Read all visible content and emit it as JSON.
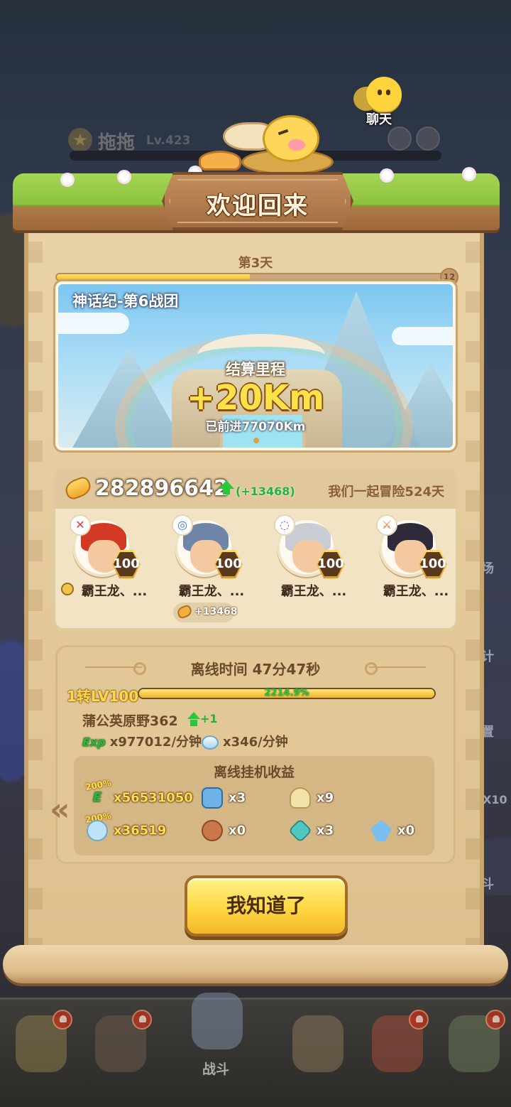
{
  "chat_label": "聊天",
  "player": {
    "name": "拖拖",
    "level": "Lv.423"
  },
  "popup": {
    "title": "欢迎回来",
    "day_label": "第3天",
    "day_progress": 0.5,
    "day_badge": "12",
    "map": {
      "name": "神话纪-第6战团",
      "settle_label": "结算里程",
      "distance_gain": "+20Km",
      "distance_total": "已前进77070Km"
    },
    "gold": {
      "amount": "282896642",
      "gain": "(+13468)",
      "together_text": "我们一起冒险524天"
    },
    "heroes": [
      {
        "name": "霸王龙、...",
        "level": "100",
        "element_color": "#e03a3a",
        "hair": "#d23a24",
        "leader": true
      },
      {
        "name": "霸王龙、...",
        "level": "100",
        "element_color": "#3a7ae0",
        "hair": "#6f86a8",
        "leader": false
      },
      {
        "name": "霸王龙、...",
        "level": "100",
        "element_color": "#8a4ad0",
        "hair": "#c9ccd3",
        "leader": false
      },
      {
        "name": "霸王龙、...",
        "level": "100",
        "element_color": "#e07a1a",
        "hair": "#2e2a3a",
        "leader": false
      }
    ],
    "hero_gold_gain": "+13468",
    "offline": {
      "title": "离线时间 47分47秒",
      "level_label": "1转LV100",
      "level_percent": "2214.9%",
      "level_fill": 1.0,
      "stage": "蒲公英原野362",
      "stage_gain": "+1",
      "exp_icon": "Exp",
      "exp_rate": "x977012/分钟",
      "gem_rate": "x346/分钟",
      "earnings_title": "离线挂机收益",
      "boost_label": "200%",
      "earnings": [
        {
          "icon": "exp-icon",
          "value": "x56531050",
          "color": "#2bb83a"
        },
        {
          "icon": "hero-shard-icon",
          "value": "x3",
          "color": "#6fb3e6"
        },
        {
          "icon": "flame-candle-icon",
          "value": "x9",
          "color": "#f3e2a8"
        },
        {
          "icon": "gem-icon",
          "value": "x36519",
          "color": "#bfe3f6"
        },
        {
          "icon": "meat-icon",
          "value": "x0",
          "color": "#c9784a"
        },
        {
          "icon": "emerald-icon",
          "value": "x3",
          "color": "#4fc7c0"
        },
        {
          "icon": "crystal-icon",
          "value": "x0",
          "color": "#7ac0ee"
        }
      ]
    },
    "confirm_label": "我知道了"
  },
  "bottom_nav": {
    "battle_label": "战斗"
  },
  "side_labels": [
    "场",
    "计",
    "置",
    "X10",
    "斗"
  ]
}
